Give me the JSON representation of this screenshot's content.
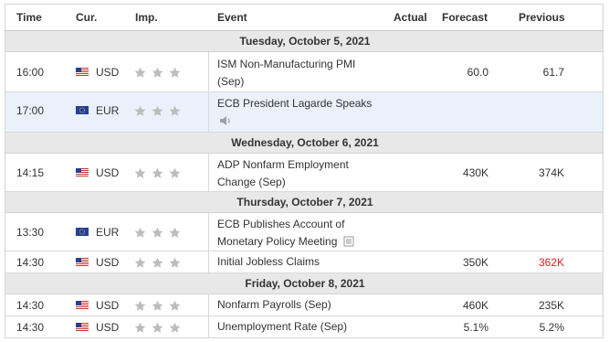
{
  "header": {
    "time": "Time",
    "currency": "Cur.",
    "importance": "Imp.",
    "event": "Event",
    "actual": "Actual",
    "forecast": "Forecast",
    "previous": "Previous"
  },
  "colors": {
    "date_bar": "#e8e8e8",
    "highlight_row": "#eaf1fb",
    "star": "#bdbdbd",
    "red_value": "#dd1d1d"
  },
  "dates": [
    "Tuesday, October 5, 2021",
    "Wednesday, October 6, 2021",
    "Thursday, October 7, 2021",
    "Friday, October 8, 2021"
  ],
  "rows": [
    {
      "time": "16:00",
      "currency": "USD",
      "flag": "us-flag-icon",
      "importance": 3,
      "event_line1": "ISM Non-Manufacturing PMI",
      "event_line2": "(Sep)",
      "actual": "",
      "forecast": "60.0",
      "previous": "61.7"
    },
    {
      "time": "17:00",
      "currency": "EUR",
      "flag": "eu-flag-icon",
      "importance": 3,
      "event_line1": "ECB President Lagarde Speaks",
      "event_line2": "",
      "actual": "",
      "forecast": "",
      "previous": "",
      "icon": "speaker-icon"
    },
    {
      "time": "14:15",
      "currency": "USD",
      "flag": "us-flag-icon",
      "importance": 3,
      "event_line1": "ADP Nonfarm Employment",
      "event_line2": "Change (Sep)",
      "actual": "",
      "forecast": "430K",
      "previous": "374K"
    },
    {
      "time": "13:30",
      "currency": "EUR",
      "flag": "eu-flag-icon",
      "importance": 3,
      "event_line1": "ECB Publishes Account of",
      "event_line2": "Monetary Policy Meeting",
      "actual": "",
      "forecast": "",
      "previous": "",
      "icon": "document-icon"
    },
    {
      "time": "14:30",
      "currency": "USD",
      "flag": "us-flag-icon",
      "importance": 3,
      "event_line1": "Initial Jobless Claims",
      "event_line2": "",
      "actual": "",
      "forecast": "350K",
      "previous": "362K",
      "previous_color": "red"
    },
    {
      "time": "14:30",
      "currency": "USD",
      "flag": "us-flag-icon",
      "importance": 3,
      "event_line1": "Nonfarm Payrolls (Sep)",
      "event_line2": "",
      "actual": "",
      "forecast": "460K",
      "previous": "235K"
    },
    {
      "time": "14:30",
      "currency": "USD",
      "flag": "us-flag-icon",
      "importance": 3,
      "event_line1": "Unemployment Rate (Sep)",
      "event_line2": "",
      "actual": "",
      "forecast": "5.1%",
      "previous": "5.2%"
    }
  ]
}
